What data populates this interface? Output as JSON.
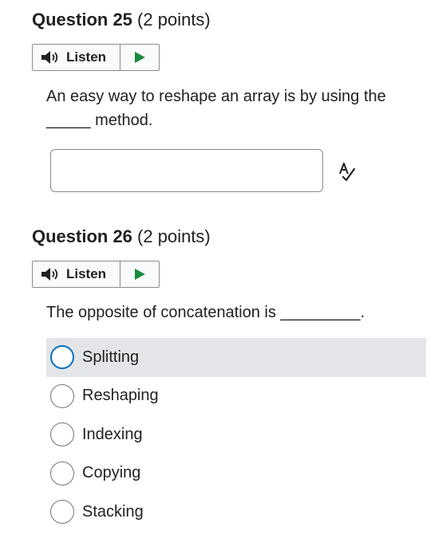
{
  "questions": [
    {
      "number_label": "Question 25",
      "points_label": "(2 points)",
      "listen_label": "Listen",
      "prompt_line1": "An easy way to reshape an array is by using the",
      "prompt_line2": "_____ method.",
      "answer_value": ""
    },
    {
      "number_label": "Question 26",
      "points_label": "(2 points)",
      "listen_label": "Listen",
      "prompt": "The opposite of concatenation is _________.",
      "options": [
        {
          "label": "Splitting",
          "selected": true
        },
        {
          "label": "Reshaping",
          "selected": false
        },
        {
          "label": "Indexing",
          "selected": false
        },
        {
          "label": "Copying",
          "selected": false
        },
        {
          "label": "Stacking",
          "selected": false
        }
      ]
    }
  ],
  "colors": {
    "accent": "#006fbf",
    "play_green": "#1a8a3c",
    "hover_bg": "#e3e5e8",
    "border": "#868c91"
  },
  "icons": {
    "speaker": "speaker-icon",
    "play": "play-icon",
    "spell_check": "spell-check-icon"
  }
}
